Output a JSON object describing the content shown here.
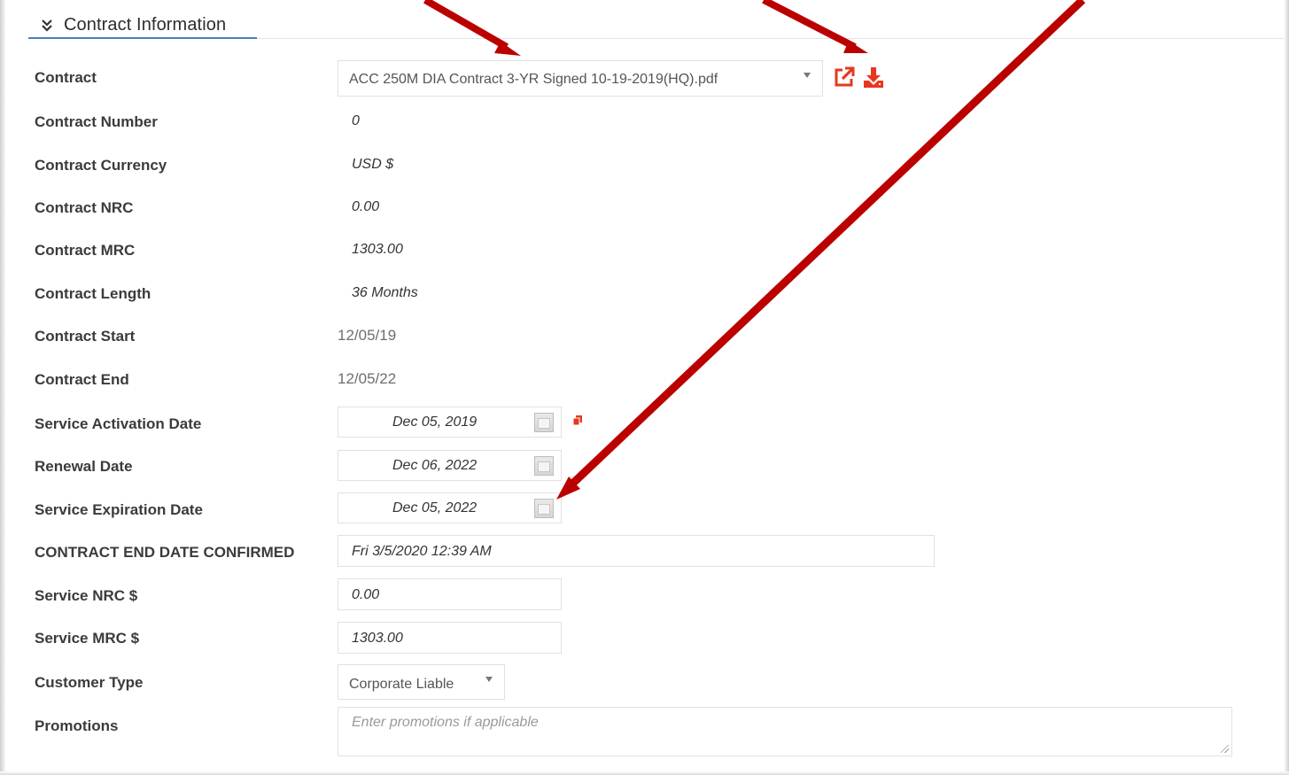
{
  "section": {
    "title": "Contract Information",
    "collapse_icon": "double-chevron-down-icon"
  },
  "fields": {
    "contract": {
      "label": "Contract",
      "value": "ACC 250M DIA Contract 3-YR Signed 10-19-2019(HQ).pdf"
    },
    "contract_number": {
      "label": "Contract Number",
      "value": "0"
    },
    "contract_currency": {
      "label": "Contract Currency",
      "value": "USD $"
    },
    "contract_nrc": {
      "label": "Contract NRC",
      "value": "0.00"
    },
    "contract_mrc": {
      "label": "Contract MRC",
      "value": "1303.00"
    },
    "contract_length": {
      "label": "Contract Length",
      "value": "36 Months"
    },
    "contract_start": {
      "label": "Contract Start",
      "value": "12/05/19"
    },
    "contract_end": {
      "label": "Contract End",
      "value": "12/05/22"
    },
    "service_activation_date": {
      "label": "Service Activation Date",
      "value": "Dec 05, 2019"
    },
    "renewal_date": {
      "label": "Renewal Date",
      "value": "Dec 06, 2022"
    },
    "service_expiration_date": {
      "label": "Service Expiration Date",
      "value": "Dec 05, 2022"
    },
    "contract_end_date_confirmed": {
      "label": "CONTRACT END DATE CONFIRMED",
      "value": "Fri 3/5/2020 12:39 AM"
    },
    "service_nrc": {
      "label": "Service NRC $",
      "value": "0.00"
    },
    "service_mrc": {
      "label": "Service MRC $",
      "value": "1303.00"
    },
    "customer_type": {
      "label": "Customer Type",
      "value": "Corporate Liable"
    },
    "promotions": {
      "label": "Promotions",
      "placeholder": "Enter promotions if applicable"
    }
  },
  "icons": {
    "open": "external-link-icon",
    "download": "download-icon",
    "copy": "copy-icon",
    "calendar": "calendar-icon"
  },
  "colors": {
    "accent_red": "#e8371f",
    "arrow_red": "#bb0000",
    "tab_underline": "#4a7ec2"
  }
}
